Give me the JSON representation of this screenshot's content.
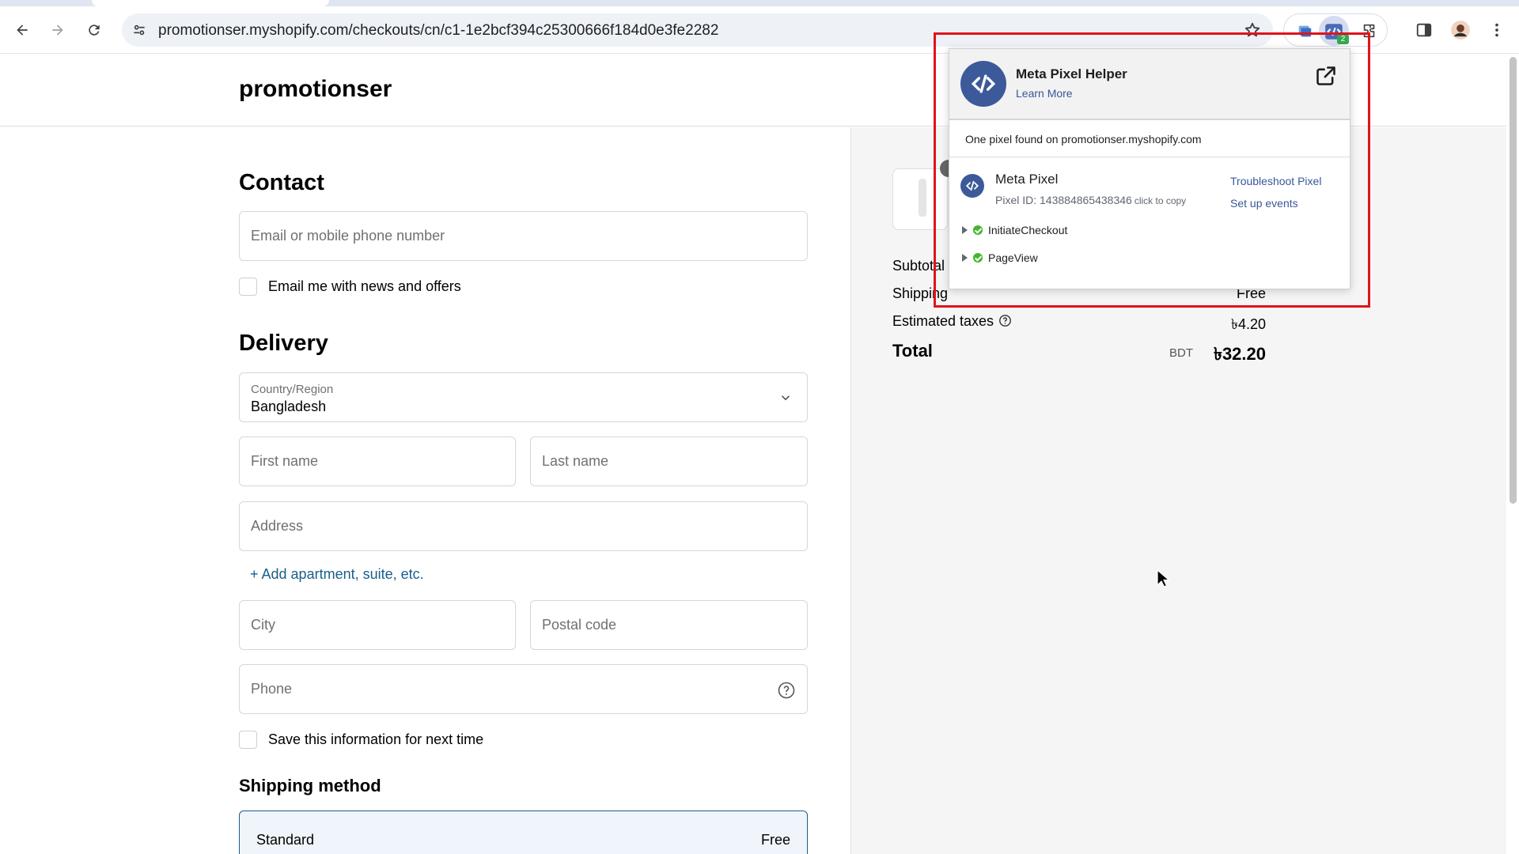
{
  "browser": {
    "url": "promotionser.myshopify.com/checkouts/cn/c1-1e2bcf394c25300666f184d0e3fe2282",
    "extension_badge": "2"
  },
  "store": {
    "name": "promotionser"
  },
  "contact": {
    "title": "Contact",
    "email_placeholder": "Email or mobile phone number",
    "news_label": "Email me with news and offers"
  },
  "delivery": {
    "title": "Delivery",
    "country_label": "Country/Region",
    "country_value": "Bangladesh",
    "first_name_placeholder": "First name",
    "last_name_placeholder": "Last name",
    "address_placeholder": "Address",
    "add_apartment": "+ Add apartment, suite, etc.",
    "city_placeholder": "City",
    "postal_placeholder": "Postal code",
    "phone_placeholder": "Phone",
    "save_info_label": "Save this information for next time"
  },
  "shipping_method": {
    "title": "Shipping method",
    "option_name": "Standard",
    "option_price": "Free"
  },
  "summary": {
    "subtotal_label": "Subtotal",
    "shipping_label": "Shipping",
    "shipping_value": "Free",
    "taxes_label": "Estimated taxes",
    "taxes_value": "৳4.20",
    "total_label": "Total",
    "total_currency": "BDT",
    "total_value": "৳32.20"
  },
  "pixel_helper": {
    "title": "Meta Pixel Helper",
    "learn_more": "Learn More",
    "found_text": "One pixel found on promotionser.myshopify.com",
    "pixel_name": "Meta Pixel",
    "pixel_id": "Pixel ID: 143884865438346",
    "click_to_copy": "click to copy",
    "troubleshoot": "Troubleshoot Pixel",
    "setup_events": "Set up events",
    "events": [
      "InitiateCheckout",
      "PageView"
    ]
  },
  "colors": {
    "highlight_box": "#e0141c",
    "link": "#1a5e8a",
    "meta_blue": "#3c5a9a",
    "success": "#42b72a"
  }
}
